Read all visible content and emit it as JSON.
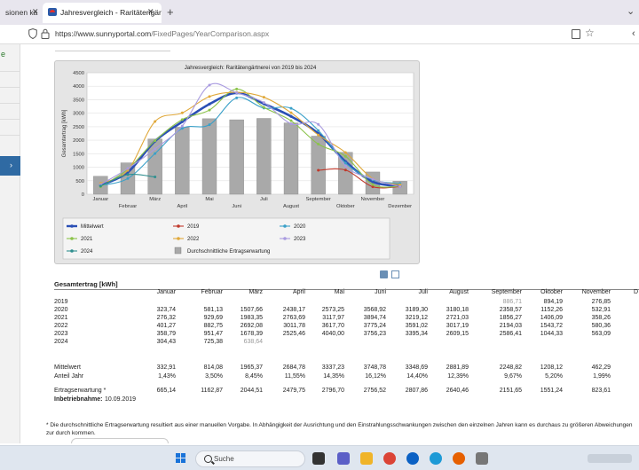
{
  "browser": {
    "tab1_title": "sionen ka",
    "tab2_title": "Jahresvergleich - Raritätengärtnerei",
    "url_host": "https://www.sunnyportal.com",
    "url_path": "/FixedPages/YearComparison.aspx"
  },
  "sidebar": {
    "letter": "e",
    "selected_arrow": "›"
  },
  "chart_data": {
    "type": "bar",
    "title": "Jahresvergleich: Raritätengärtnerei von 2019 bis 2024",
    "ylabel": "Gesamtertrag [kWh]",
    "ylim": [
      0,
      4500
    ],
    "yticks": [
      0,
      500,
      1000,
      1500,
      2000,
      2500,
      3000,
      3500,
      4000,
      4500
    ],
    "categories": [
      "Januar",
      "Februar",
      "März",
      "April",
      "Mai",
      "Juni",
      "Juli",
      "August",
      "September",
      "Oktober",
      "November",
      "Dezember"
    ],
    "bars": {
      "name": "Durchschnittliche Ertragserwartung",
      "color": "#a9a9a9",
      "values": [
        665.14,
        1162.87,
        2044.51,
        2479.75,
        2796.7,
        2756.52,
        2807.86,
        2640.46,
        2151.65,
        1551.24,
        823.61,
        480
      ]
    },
    "series": [
      {
        "name": "Mittelwert",
        "color": "#2a4fb5",
        "values": [
          332.91,
          814.08,
          1965.37,
          2684.78,
          3337.23,
          3748.78,
          3348.69,
          2881.89,
          2248.82,
          1208.12,
          462.29,
          300
        ]
      },
      {
        "name": "2019",
        "color": "#c0392b",
        "values": [
          null,
          null,
          null,
          null,
          null,
          null,
          null,
          null,
          886.71,
          894.19,
          276.85,
          280
        ]
      },
      {
        "name": "2020",
        "color": "#3aa0c8",
        "values": [
          323.74,
          581.13,
          1507.66,
          2438.17,
          2573.25,
          3568.92,
          3189.3,
          3180.18,
          2358.57,
          1152.26,
          532.91,
          400
        ]
      },
      {
        "name": "2021",
        "color": "#8bc34a",
        "values": [
          276.32,
          929.69,
          1983.35,
          2763.69,
          3117.97,
          3894.74,
          3219.12,
          2721.03,
          1856.27,
          1406.09,
          358.26,
          300
        ]
      },
      {
        "name": "2022",
        "color": "#e0a83a",
        "values": [
          401.27,
          882.75,
          2692.08,
          3011.78,
          3617.7,
          3775.24,
          3591.02,
          3017.19,
          2194.03,
          1543.72,
          580.36,
          350
        ]
      },
      {
        "name": "2023",
        "color": "#a99be0",
        "values": [
          358.79,
          951.47,
          1678.39,
          2525.46,
          4040.0,
          3756.23,
          3395.34,
          2609.15,
          2586.41,
          1044.33,
          563.09,
          280
        ]
      },
      {
        "name": "2024",
        "color": "#2f8f8f",
        "values": [
          304.43,
          725.38,
          638.64,
          null,
          null,
          null,
          null,
          null,
          null,
          null,
          null,
          null
        ]
      }
    ],
    "legend_placement": "bottom",
    "legend_entries": [
      "Mittelwert",
      "2019",
      "2020",
      "2021",
      "2022",
      "2023",
      "2024",
      "Durchschnittliche Ertragserwartung"
    ],
    "grid": true
  },
  "table": {
    "title": "Gesamtertrag [kWh]",
    "headers": [
      "Januar",
      "Februar",
      "März",
      "April",
      "Mai",
      "Juni",
      "Juli",
      "August",
      "September",
      "Oktober",
      "November",
      "D"
    ],
    "rows": [
      {
        "label": "2019",
        "values": [
          "",
          "",
          "",
          "",
          "",
          "",
          "",
          "",
          "886,71",
          "894,19",
          "276,85",
          ""
        ],
        "muted_index": 8
      },
      {
        "label": "2020",
        "values": [
          "323,74",
          "581,13",
          "1507,66",
          "2438,17",
          "2573,25",
          "3568,92",
          "3189,30",
          "3180,18",
          "2358,57",
          "1152,26",
          "532,91",
          ""
        ]
      },
      {
        "label": "2021",
        "values": [
          "276,32",
          "929,69",
          "1983,35",
          "2763,69",
          "3117,97",
          "3894,74",
          "3219,12",
          "2721,03",
          "1856,27",
          "1406,09",
          "358,26",
          ""
        ]
      },
      {
        "label": "2022",
        "values": [
          "401,27",
          "882,75",
          "2692,08",
          "3011,78",
          "3617,70",
          "3775,24",
          "3591,02",
          "3017,19",
          "2194,03",
          "1543,72",
          "580,36",
          ""
        ]
      },
      {
        "label": "2023",
        "values": [
          "358,79",
          "951,47",
          "1678,39",
          "2525,46",
          "4040,00",
          "3756,23",
          "3395,34",
          "2609,15",
          "2586,41",
          "1044,33",
          "563,09",
          ""
        ]
      },
      {
        "label": "2024",
        "values": [
          "304,43",
          "725,38",
          "638,64",
          "",
          "",
          "",
          "",
          "",
          "",
          "",
          "",
          ""
        ],
        "muted_index": 2
      }
    ],
    "mittelwert": {
      "label": "Mittelwert",
      "values": [
        "332,91",
        "814,08",
        "1965,37",
        "2684,78",
        "3337,23",
        "3748,78",
        "3348,69",
        "2881,89",
        "2248,82",
        "1208,12",
        "462,29",
        ""
      ]
    },
    "anteil": {
      "label": "Anteil Jahr",
      "values": [
        "1,43%",
        "3,50%",
        "8,45%",
        "11,55%",
        "14,35%",
        "16,12%",
        "14,40%",
        "12,39%",
        "9,67%",
        "5,20%",
        "1,99%",
        ""
      ]
    },
    "erwartung": {
      "label": "Ertragserwartung *",
      "values": [
        "665,14",
        "1162,87",
        "2044,51",
        "2479,75",
        "2796,70",
        "2756,52",
        "2807,86",
        "2640,46",
        "2151,65",
        "1551,24",
        "823,61",
        ""
      ]
    },
    "inbetriebnahme_label": "Inbetriebnahme:",
    "inbetriebnahme_value": "10.09.2019"
  },
  "footnote": "* Die durchschnittliche Ertragserwartung resultiert aus einer manuellen Vorgabe. In Abhängigkeit der Ausrichtung und den Einstrahlungsschwankungen zwischen den einzelnen Jahren kann es durchaus zu größeren Abweichungen zur durch kommen.",
  "taskbar": {
    "search_label": "Suche"
  }
}
